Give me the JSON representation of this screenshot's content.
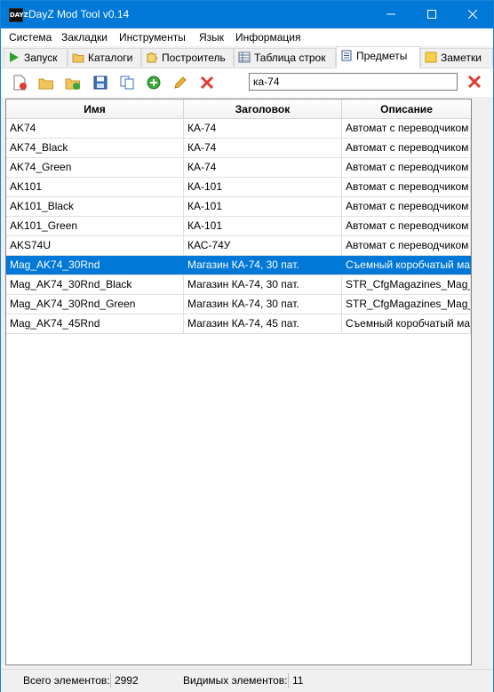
{
  "window": {
    "title": "DayZ Mod Tool  v0.14",
    "app_icon_text": "DAYZ"
  },
  "menu": [
    "Система",
    "Закладки",
    "Инструменты",
    "Язык",
    "Информация"
  ],
  "tabs": [
    "Запуск",
    "Каталоги",
    "Построитель",
    "Таблица строк",
    "Предметы",
    "Заметки"
  ],
  "active_tab": "Предметы",
  "search": {
    "value": "ка-74"
  },
  "table": {
    "columns": [
      "Имя",
      "Заголовок",
      "Описание"
    ],
    "rows": [
      [
        "AK74",
        "КА-74",
        "Автомат с переводчиком"
      ],
      [
        "AK74_Black",
        "КА-74",
        "Автомат с переводчиком"
      ],
      [
        "AK74_Green",
        "КА-74",
        "Автомат с переводчиком"
      ],
      [
        "AK101",
        "КА-101",
        "Автомат с переводчиком"
      ],
      [
        "AK101_Black",
        "КА-101",
        "Автомат с переводчиком"
      ],
      [
        "AK101_Green",
        "КА-101",
        "Автомат с переводчиком"
      ],
      [
        "AKS74U",
        "КАС-74У",
        "Автомат с переводчиком"
      ],
      [
        "Mag_AK74_30Rnd",
        "Магазин КА-74, 30 пат.",
        "Съемный коробчатый ма"
      ],
      [
        "Mag_AK74_30Rnd_Black",
        "Магазин КА-74, 30 пат.",
        "STR_CfgMagazines_Mag_A"
      ],
      [
        "Mag_AK74_30Rnd_Green",
        "Магазин КА-74, 30 пат.",
        "STR_CfgMagazines_Mag_A"
      ],
      [
        "Mag_AK74_45Rnd",
        "Магазин КА-74, 45 пат.",
        "Съемный коробчатый ма"
      ]
    ],
    "selected_row": 7
  },
  "status": {
    "total_label": "Всего элементов:",
    "total_value": "2992",
    "visible_label": "Видимых элементов:",
    "visible_value": "11"
  },
  "colors": {
    "accent": "#0078d7",
    "selection": "#0078d7"
  }
}
